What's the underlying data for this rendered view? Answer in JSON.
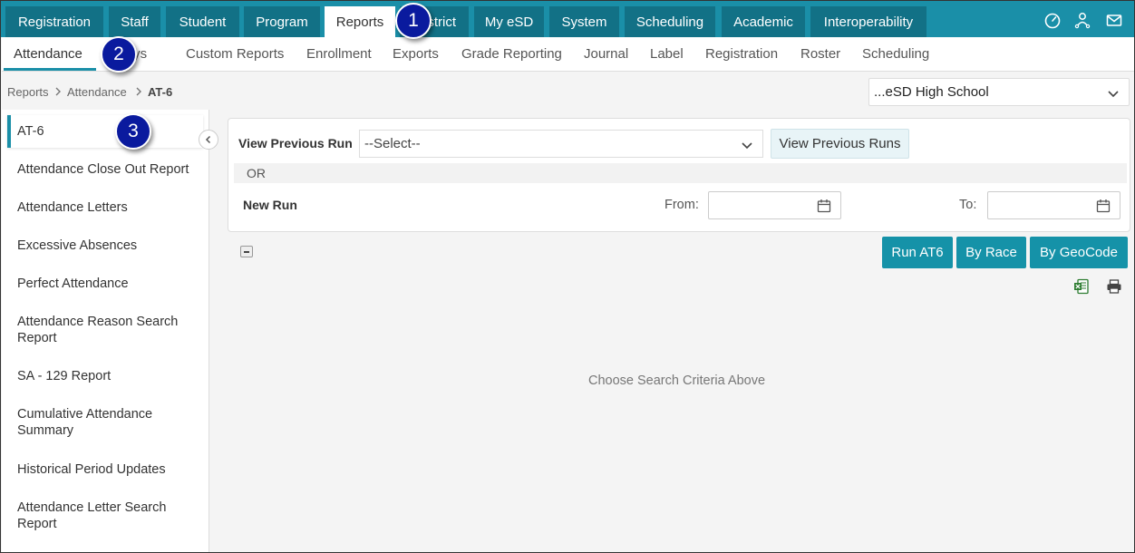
{
  "top_nav": {
    "tabs": [
      "Registration",
      "Staff",
      "Student",
      "Program",
      "Reports",
      "District",
      "My eSD",
      "System",
      "Scheduling",
      "Academic",
      "Interoperability"
    ],
    "active": "Reports",
    "icons": [
      "dashboard-icon",
      "user-network-icon",
      "mail-icon"
    ]
  },
  "sub_nav": {
    "items": [
      "Attendance",
      "Days",
      "Custom Reports",
      "Enrollment",
      "Exports",
      "Grade Reporting",
      "Journal",
      "Label",
      "Registration",
      "Roster",
      "Scheduling"
    ],
    "active": "Attendance"
  },
  "breadcrumb": [
    "Reports",
    "Attendance",
    "AT-6"
  ],
  "school_select": {
    "value": "...eSD High School"
  },
  "sidebar": {
    "items": [
      "AT-6",
      "Attendance Close Out Report",
      "Attendance Letters",
      "Excessive Absences",
      "Perfect Attendance",
      "Attendance Reason Search Report",
      "SA - 129 Report",
      "Cumulative Attendance Summary",
      "Historical Period Updates",
      "Attendance Letter Search Report"
    ],
    "active": "AT-6"
  },
  "form": {
    "view_previous_run_label": "View Previous Run",
    "select_placeholder": "--Select--",
    "view_previous_runs_button": "View Previous Runs",
    "or_label": "OR",
    "new_run_label": "New Run",
    "from_label": "From:",
    "to_label": "To:"
  },
  "actions": [
    "Run AT6",
    "By Race",
    "By GeoCode"
  ],
  "empty_message": "Choose Search Criteria Above",
  "callouts": [
    "1",
    "2",
    "3"
  ],
  "colors": {
    "accent": "#1a8fa8",
    "tab_dark": "#127186",
    "button": "#1592a8",
    "callout": "#0a1a9e"
  }
}
